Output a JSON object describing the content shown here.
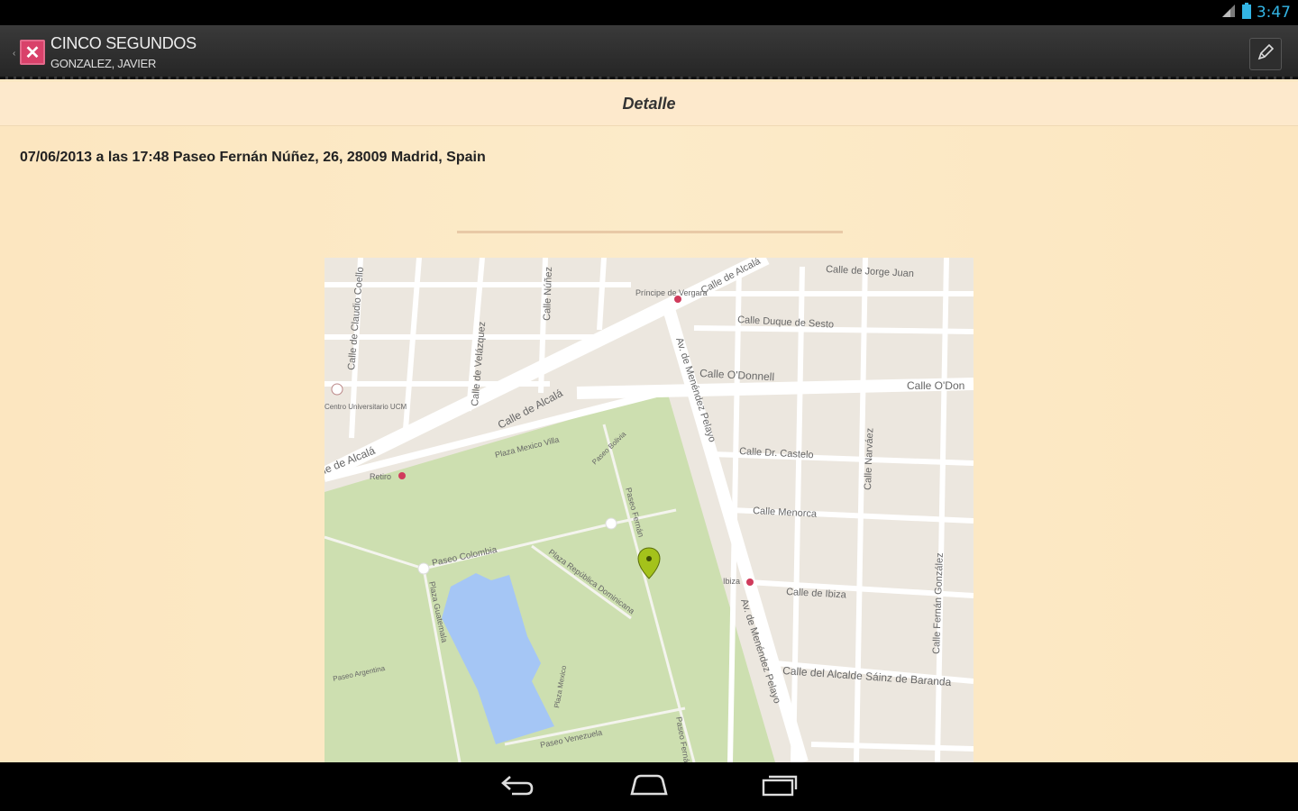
{
  "status_bar": {
    "time": "3:47",
    "icons": [
      "signal-icon",
      "battery-icon"
    ]
  },
  "action_bar": {
    "title": "CINCO SEGUNDOS",
    "subtitle": "GONZALEZ, JAVIER",
    "app_icon_glyph": "✕",
    "edit_icon": "pencil-icon"
  },
  "detail": {
    "header": "Detalle"
  },
  "event": {
    "text": "07/06/2013 a las 17:48 Paseo Fernán Núñez, 26, 28009 Madrid, Spain"
  },
  "map": {
    "labels": {
      "alcala_top": "Calle de Alcalá",
      "alcala_mid": "Calle de Alcalá",
      "alcala_left": "le de Alcalá",
      "jorge_juan": "Calle de Jorge Juan",
      "duque_sesto": "Calle Duque de Sesto",
      "odonnell": "Calle O'Donnell",
      "odonnell_right": "Calle O'Don",
      "dr_castelo": "Calle Dr. Castelo",
      "menorca": "Calle Menorca",
      "ibiza": "Calle de Ibiza",
      "alcalde": "Calle del Alcalde Sáinz de Baranda",
      "menendez_top": "Av. de Menéndez Pelayo",
      "menendez_bottom": "Av. de Menéndez Pelayo",
      "narvaez": "Calle Narváez",
      "fernan_gonzalez": "Calle Fernán González",
      "velazquez": "Calle de Velázquez",
      "claudio_coello": "Calle de Claudio Coello",
      "nunez": "Calle Núñez",
      "principe_vergara": "Príncipe de Vergara",
      "retiro": "Retiro",
      "ibiza_metro": "Ibiza",
      "centro": "Centro Universitario UCM",
      "plaza_mexico": "Plaza Mexico Villa",
      "paseo_colombia": "Paseo Colombia",
      "plaza_republica": "Plaza República Dominicana",
      "paseo_fernan": "Paseo Fernán",
      "paseo_venezuela": "Paseo Venezuela",
      "paseo_argentina": "Paseo Argentina",
      "plaza_guatemala": "Plaza Guatemala",
      "paseo_fernan2": "Paseo Fernán",
      "paseo_bolivia": "Paseo Bolivia",
      "plaza_mexico2": "Plaza Mexico"
    }
  }
}
